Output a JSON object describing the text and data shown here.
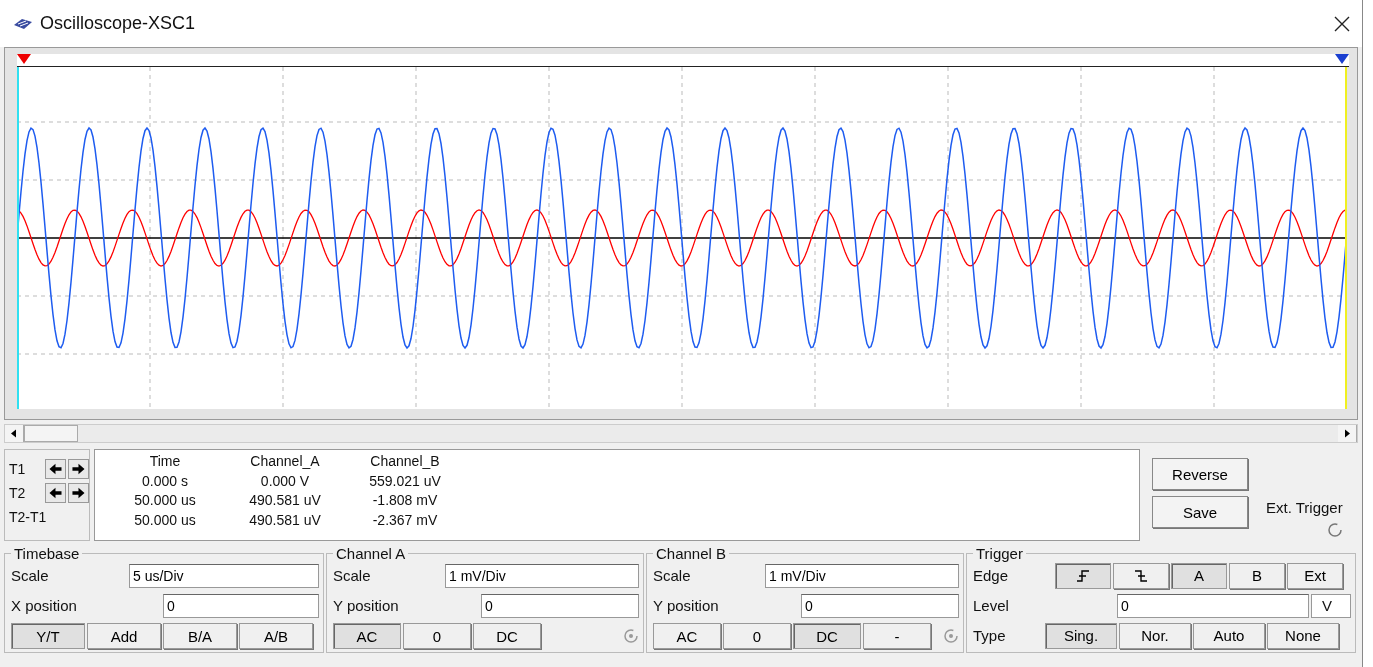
{
  "window": {
    "title": "Oscilloscope-XSC1"
  },
  "readout": {
    "columns": [
      "Time",
      "Channel_A",
      "Channel_B"
    ],
    "rows": [
      {
        "label": "T1",
        "kind": "cursor",
        "values": [
          "0.000 s",
          "0.000 V",
          "559.021 uV"
        ]
      },
      {
        "label": "T2",
        "kind": "cursor",
        "values": [
          "50.000 us",
          "490.581 uV",
          "-1.808 mV"
        ]
      },
      {
        "label": "T2-T1",
        "kind": "difference",
        "values": [
          "50.000 us",
          "490.581 uV",
          "-2.367 mV"
        ]
      }
    ]
  },
  "buttons": [
    "Reverse",
    "Save"
  ],
  "ext_trigger": {
    "label": "Ext. Trigger"
  },
  "timebase": {
    "title": "Timebase",
    "fields": [
      {
        "label": "Scale",
        "value": "5 us/Div"
      },
      {
        "label": "X position",
        "value": "0"
      }
    ],
    "modes": [
      {
        "label": "Y/T",
        "selected": true
      },
      {
        "label": "Add",
        "selected": false
      },
      {
        "label": "B/A",
        "selected": false
      },
      {
        "label": "A/B",
        "selected": false
      }
    ]
  },
  "channels": [
    {
      "title": "Channel A",
      "fields": [
        {
          "label": "Scale",
          "value": "1 mV/Div"
        },
        {
          "label": "Y position",
          "value": "0"
        }
      ],
      "coupling": [
        {
          "label": "AC",
          "selected": true
        },
        {
          "label": "0",
          "selected": false
        },
        {
          "label": "DC",
          "selected": false
        }
      ]
    },
    {
      "title": "Channel B",
      "fields": [
        {
          "label": "Scale",
          "value": "1 mV/Div"
        },
        {
          "label": "Y position",
          "value": "0"
        }
      ],
      "coupling": [
        {
          "label": "AC",
          "selected": false
        },
        {
          "label": "0",
          "selected": false
        },
        {
          "label": "DC",
          "selected": true
        },
        {
          "label": "-",
          "selected": false
        }
      ]
    }
  ],
  "trigger": {
    "title": "Trigger",
    "edge_label": "Edge",
    "edges": [
      {
        "kind": "rising",
        "selected": true
      },
      {
        "kind": "falling",
        "selected": false
      }
    ],
    "sources": [
      {
        "label": "A",
        "selected": true
      },
      {
        "label": "B",
        "selected": false
      },
      {
        "label": "Ext",
        "selected": false
      }
    ],
    "level_label": "Level",
    "level_value": "0",
    "level_unit": "V",
    "type_label": "Type",
    "types": [
      {
        "label": "Sing.",
        "selected": true
      },
      {
        "label": "Nor.",
        "selected": false
      },
      {
        "label": "Auto",
        "selected": false
      },
      {
        "label": "None",
        "selected": false
      }
    ]
  }
}
